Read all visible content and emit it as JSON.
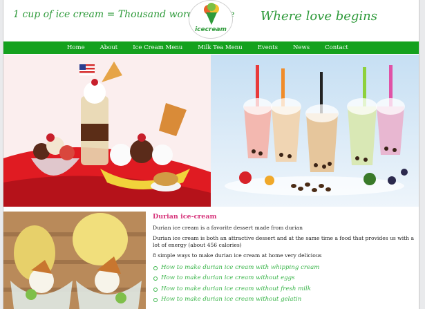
{
  "header": {
    "tagline_left": "1 cup of ice cream = Thousand words of love",
    "tagline_right": "Where love begins",
    "logo_text": "icecream"
  },
  "nav": {
    "items": [
      "Home",
      "About",
      "Ice Cream Menu",
      "Milk Tea Menu",
      "Events",
      "News",
      "Contact"
    ]
  },
  "article": {
    "title": "Durian ice-cream",
    "paragraphs": [
      "Durian ice cream is a favorite dessert made from durian",
      "Durian ice cream is both an attractive dessert and at the same time a food that provides us with a lot of energy (about 456 calories)",
      "8 simple ways to make durian ice cream at home very delicious"
    ],
    "links": [
      "How to make durian ice cream with whipping cream",
      "How to make durian ice cream without eggs",
      "How to make durian ice cream without fresh milk",
      "How to make durian ice cream without gelatin"
    ]
  },
  "colors": {
    "brand_green": "#14a11e",
    "tagline_green": "#2e9a3a",
    "title_pink": "#d6337a",
    "link_green": "#38b448"
  }
}
